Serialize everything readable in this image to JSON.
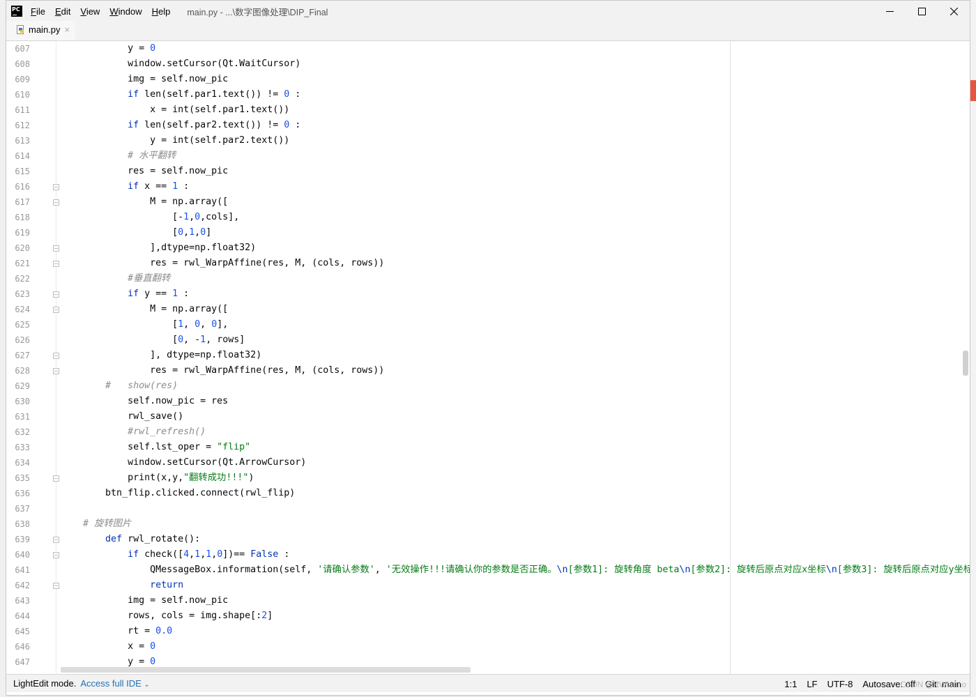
{
  "app": {
    "logo_text": "PC",
    "menu": [
      "File",
      "Edit",
      "View",
      "Window",
      "Help"
    ],
    "menu_mnemonics": [
      "F",
      "E",
      "V",
      "W",
      "H"
    ],
    "title": "main.py - ...\\数字图像处理\\DIP_Final"
  },
  "tabs": [
    {
      "label": "main.py",
      "close": "×"
    }
  ],
  "editor": {
    "lines": [
      {
        "n": "607",
        "fold": false,
        "tokens": [
          [
            "",
            "            y = "
          ],
          [
            "num",
            "0"
          ]
        ]
      },
      {
        "n": "608",
        "fold": false,
        "tokens": [
          [
            "",
            "            window.setCursor(Qt.WaitCursor)"
          ]
        ]
      },
      {
        "n": "609",
        "fold": false,
        "tokens": [
          [
            "",
            "            img = self.now_pic"
          ]
        ]
      },
      {
        "n": "610",
        "fold": false,
        "tokens": [
          [
            "",
            "            "
          ],
          [
            "kw",
            "if"
          ],
          [
            "",
            " len(self.par1.text()) != "
          ],
          [
            "num",
            "0"
          ],
          [
            "",
            " :"
          ]
        ]
      },
      {
        "n": "611",
        "fold": false,
        "tokens": [
          [
            "",
            "                x = int(self.par1.text())"
          ]
        ]
      },
      {
        "n": "612",
        "fold": false,
        "tokens": [
          [
            "",
            "            "
          ],
          [
            "kw",
            "if"
          ],
          [
            "",
            " len(self.par2.text()) != "
          ],
          [
            "num",
            "0"
          ],
          [
            "",
            " :"
          ]
        ]
      },
      {
        "n": "613",
        "fold": false,
        "tokens": [
          [
            "",
            "                y = int(self.par2.text())"
          ]
        ]
      },
      {
        "n": "614",
        "fold": false,
        "tokens": [
          [
            "",
            "            "
          ],
          [
            "cmt",
            "# 水平翻转"
          ]
        ]
      },
      {
        "n": "615",
        "fold": false,
        "tokens": [
          [
            "",
            "            res = self.now_pic"
          ]
        ]
      },
      {
        "n": "616",
        "fold": true,
        "tokens": [
          [
            "",
            "            "
          ],
          [
            "kw",
            "if"
          ],
          [
            "",
            " x == "
          ],
          [
            "num",
            "1"
          ],
          [
            "",
            " :"
          ]
        ]
      },
      {
        "n": "617",
        "fold": true,
        "tokens": [
          [
            "",
            "                M = np.array(["
          ]
        ]
      },
      {
        "n": "618",
        "fold": false,
        "tokens": [
          [
            "",
            "                    [-"
          ],
          [
            "num",
            "1"
          ],
          [
            "",
            ","
          ],
          [
            "num",
            "0"
          ],
          [
            "",
            ",cols],"
          ]
        ]
      },
      {
        "n": "619",
        "fold": false,
        "tokens": [
          [
            "",
            "                    ["
          ],
          [
            "num",
            "0"
          ],
          [
            "",
            ","
          ],
          [
            "num",
            "1"
          ],
          [
            "",
            ","
          ],
          [
            "num",
            "0"
          ],
          [
            "",
            "]"
          ]
        ]
      },
      {
        "n": "620",
        "fold": true,
        "tokens": [
          [
            "",
            "                ],dtype=np.float32)"
          ]
        ]
      },
      {
        "n": "621",
        "fold": true,
        "tokens": [
          [
            "",
            "                res = rwl_WarpAffine(res, M, (cols, rows))"
          ]
        ]
      },
      {
        "n": "622",
        "fold": false,
        "tokens": [
          [
            "",
            "            "
          ],
          [
            "cmt",
            "#垂直翻转"
          ]
        ]
      },
      {
        "n": "623",
        "fold": true,
        "tokens": [
          [
            "",
            "            "
          ],
          [
            "kw",
            "if"
          ],
          [
            "",
            " y == "
          ],
          [
            "num",
            "1"
          ],
          [
            "",
            " :"
          ]
        ]
      },
      {
        "n": "624",
        "fold": true,
        "tokens": [
          [
            "",
            "                M = np.array(["
          ]
        ]
      },
      {
        "n": "625",
        "fold": false,
        "tokens": [
          [
            "",
            "                    ["
          ],
          [
            "num",
            "1"
          ],
          [
            "",
            ", "
          ],
          [
            "num",
            "0"
          ],
          [
            "",
            ", "
          ],
          [
            "num",
            "0"
          ],
          [
            "",
            "],"
          ]
        ]
      },
      {
        "n": "626",
        "fold": false,
        "tokens": [
          [
            "",
            "                    ["
          ],
          [
            "num",
            "0"
          ],
          [
            "",
            ", -"
          ],
          [
            "num",
            "1"
          ],
          [
            "",
            ", rows]"
          ]
        ]
      },
      {
        "n": "627",
        "fold": true,
        "tokens": [
          [
            "",
            "                ], dtype=np.float32)"
          ]
        ]
      },
      {
        "n": "628",
        "fold": true,
        "tokens": [
          [
            "",
            "                res = rwl_WarpAffine(res, M, (cols, rows))"
          ]
        ]
      },
      {
        "n": "629",
        "fold": false,
        "tokens": [
          [
            "",
            "        "
          ],
          [
            "cmt",
            "#   show(res)"
          ]
        ]
      },
      {
        "n": "630",
        "fold": false,
        "tokens": [
          [
            "",
            "            self.now_pic = res"
          ]
        ]
      },
      {
        "n": "631",
        "fold": false,
        "tokens": [
          [
            "",
            "            rwl_save()"
          ]
        ]
      },
      {
        "n": "632",
        "fold": false,
        "tokens": [
          [
            "",
            "            "
          ],
          [
            "cmt",
            "#rwl_refresh()"
          ]
        ]
      },
      {
        "n": "633",
        "fold": false,
        "tokens": [
          [
            "",
            "            self.lst_oper = "
          ],
          [
            "str",
            "\"flip\""
          ]
        ]
      },
      {
        "n": "634",
        "fold": false,
        "tokens": [
          [
            "",
            "            window.setCursor(Qt.ArrowCursor)"
          ]
        ]
      },
      {
        "n": "635",
        "fold": true,
        "tokens": [
          [
            "",
            "            print(x,y,"
          ],
          [
            "str",
            "\"翻转成功!!!\""
          ],
          [
            "",
            ")"
          ]
        ]
      },
      {
        "n": "636",
        "fold": false,
        "tokens": [
          [
            "",
            "        btn_flip.clicked.connect(rwl_flip)"
          ]
        ]
      },
      {
        "n": "637",
        "fold": false,
        "tokens": [
          [
            "",
            ""
          ]
        ]
      },
      {
        "n": "638",
        "fold": false,
        "tokens": [
          [
            "",
            "    "
          ],
          [
            "cmt",
            "# 旋转图片"
          ]
        ]
      },
      {
        "n": "639",
        "fold": true,
        "tokens": [
          [
            "",
            "        "
          ],
          [
            "kw",
            "def"
          ],
          [
            "",
            " rwl_rotate():"
          ]
        ]
      },
      {
        "n": "640",
        "fold": true,
        "tokens": [
          [
            "",
            "            "
          ],
          [
            "kw",
            "if"
          ],
          [
            "",
            " check(["
          ],
          [
            "num",
            "4"
          ],
          [
            "",
            ","
          ],
          [
            "num",
            "1"
          ],
          [
            "",
            ","
          ],
          [
            "num",
            "1"
          ],
          [
            "",
            ","
          ],
          [
            "num",
            "0"
          ],
          [
            "",
            "])== "
          ],
          [
            "kw",
            "False"
          ],
          [
            "",
            " :"
          ]
        ]
      },
      {
        "n": "641",
        "fold": false,
        "tokens": [
          [
            "",
            "                QMessageBox.information(self, "
          ],
          [
            "str",
            "'请确认参数'"
          ],
          [
            "",
            ", "
          ],
          [
            "str",
            "'无效操作!!!请确认你的参数是否正确。"
          ],
          [
            "kw",
            "\\n"
          ],
          [
            "str",
            "[参数1]: 旋转角度 beta"
          ],
          [
            "kw",
            "\\n"
          ],
          [
            "str",
            "[参数2]: 旋转后原点对应x坐标"
          ],
          [
            "kw",
            "\\n"
          ],
          [
            "str",
            "[参数3]: 旋转后原点对应y坐标"
          ],
          [
            "kw",
            "\\"
          ]
        ]
      },
      {
        "n": "642",
        "fold": true,
        "tokens": [
          [
            "",
            "                "
          ],
          [
            "kw",
            "return"
          ]
        ]
      },
      {
        "n": "643",
        "fold": false,
        "tokens": [
          [
            "",
            "            img = self.now_pic"
          ]
        ]
      },
      {
        "n": "644",
        "fold": false,
        "tokens": [
          [
            "",
            "            rows, cols = img.shape[:"
          ],
          [
            "num",
            "2"
          ],
          [
            "",
            "]"
          ]
        ]
      },
      {
        "n": "645",
        "fold": false,
        "tokens": [
          [
            "",
            "            rt = "
          ],
          [
            "num",
            "0.0"
          ]
        ]
      },
      {
        "n": "646",
        "fold": false,
        "tokens": [
          [
            "",
            "            x = "
          ],
          [
            "num",
            "0"
          ]
        ]
      },
      {
        "n": "647",
        "fold": false,
        "tokens": [
          [
            "",
            "            y = "
          ],
          [
            "num",
            "0"
          ]
        ]
      }
    ]
  },
  "status": {
    "mode": "LightEdit mode.",
    "link": "Access full IDE",
    "position": "1:1",
    "line_sep": "LF",
    "encoding": "UTF-8",
    "autosave": "Autosave: off",
    "git": "Git: main"
  },
  "watermark": "CSDN @RWLinno",
  "colors": {
    "keyword": "#0033b3",
    "number": "#1750eb",
    "string": "#067d17",
    "comment": "#8c8c8c",
    "link": "#2470b3"
  }
}
